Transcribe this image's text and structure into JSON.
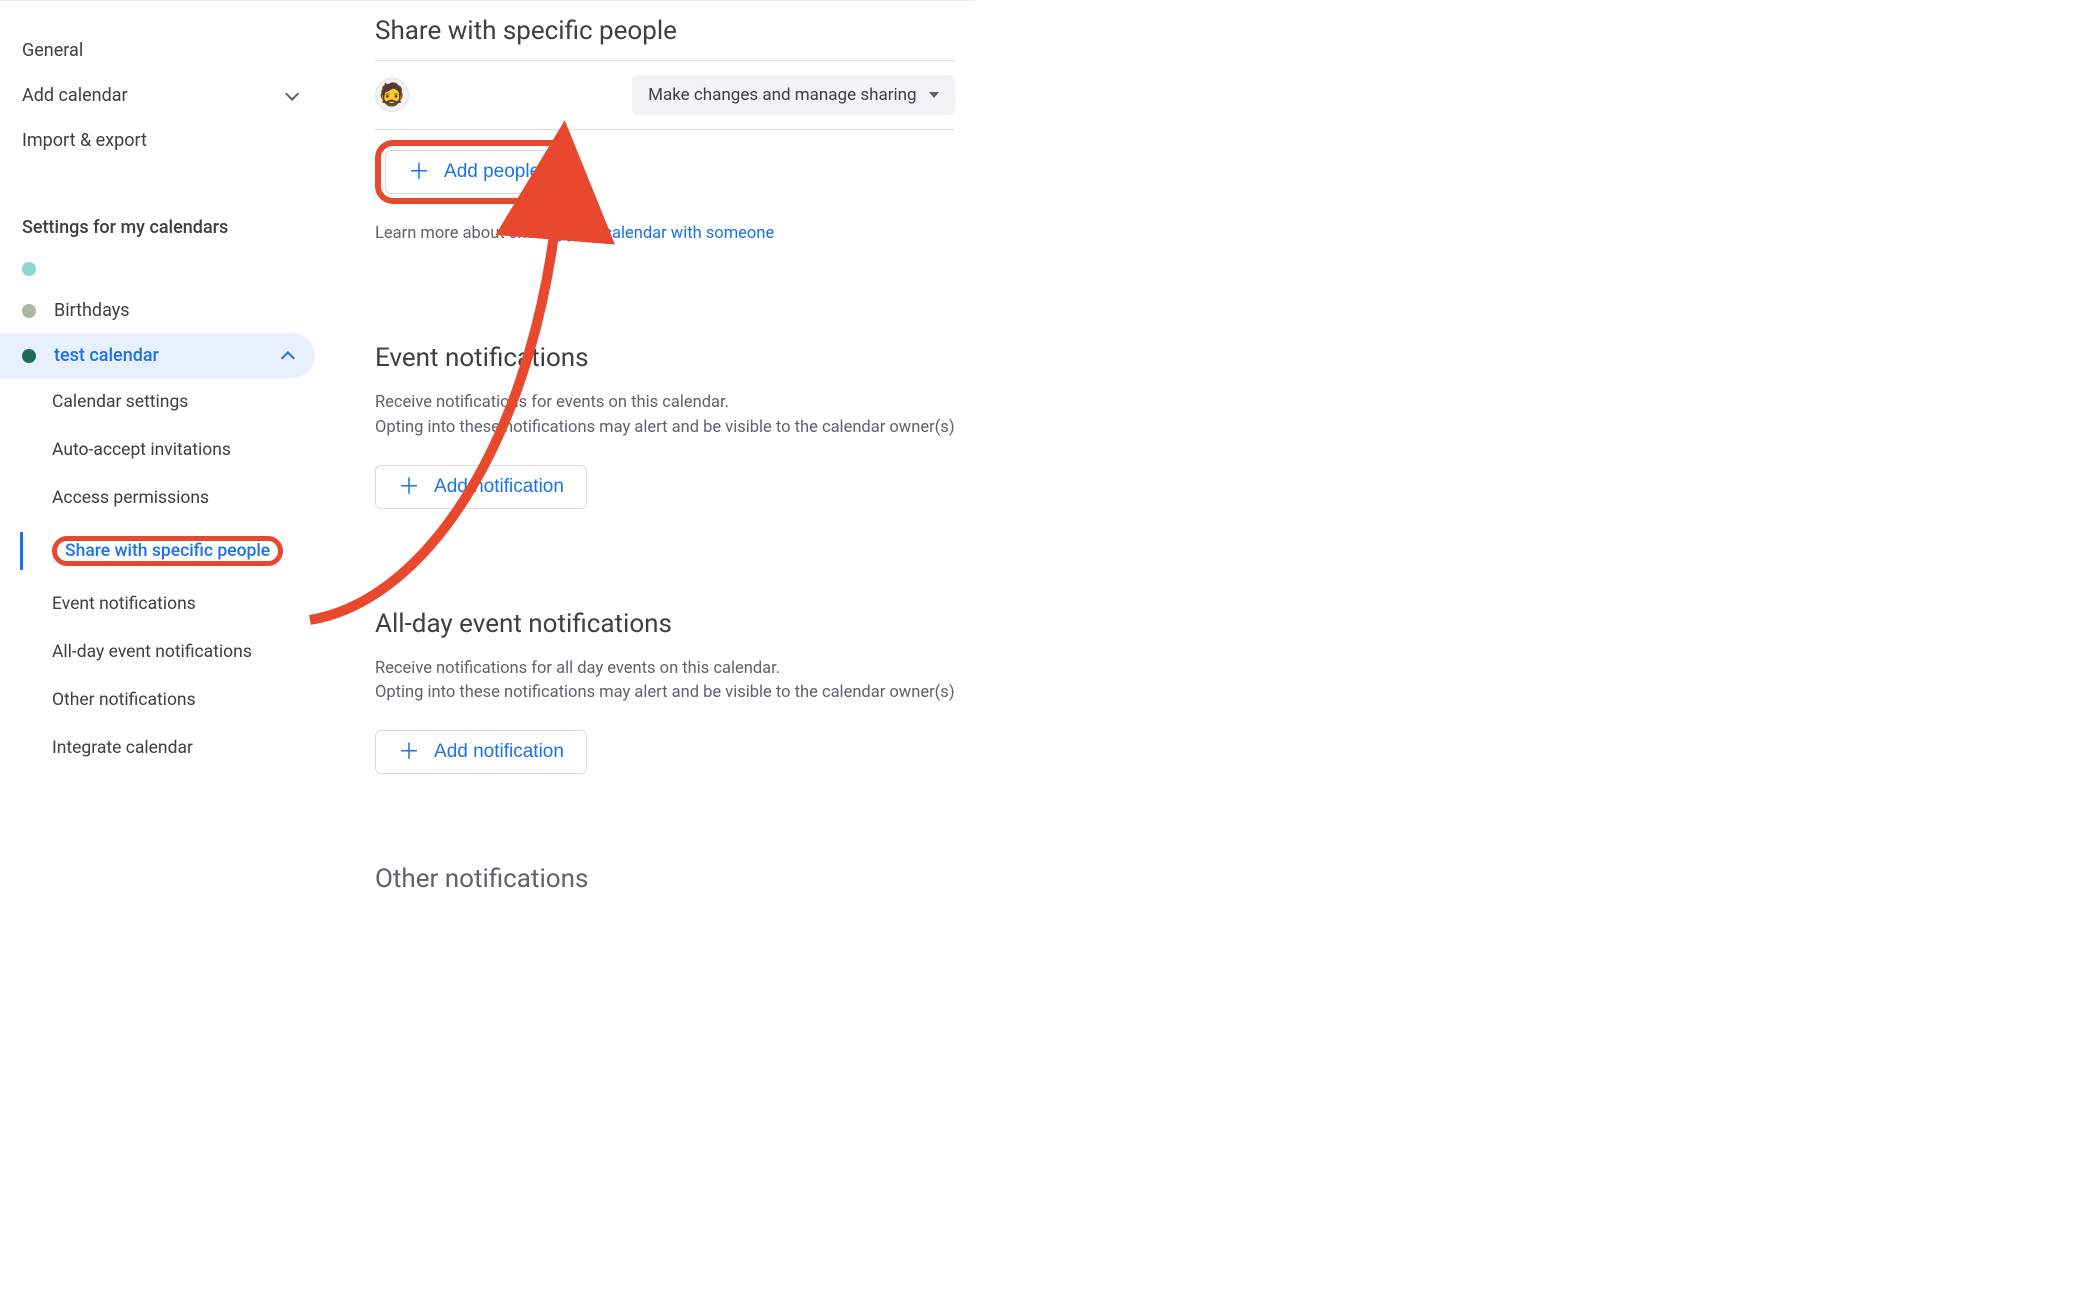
{
  "sidebar": {
    "general": "General",
    "add_calendar": "Add calendar",
    "import_export": "Import & export",
    "my_calendars_header": "Settings for my calendars",
    "calendars": [
      {
        "name": "",
        "color": "#8fd7cc"
      },
      {
        "name": "Birthdays",
        "color": "#a9b7a3"
      },
      {
        "name": "test calendar",
        "color": "#1b6b55",
        "selected": true
      }
    ],
    "subitems": [
      "Calendar settings",
      "Auto-accept invitations",
      "Access permissions",
      "Share with specific people",
      "Event notifications",
      "All-day event notifications",
      "Other notifications",
      "Integrate calendar"
    ],
    "active_subitem_index": 3
  },
  "share_section": {
    "title": "Share with specific people",
    "permission_label": "Make changes and manage sharing",
    "add_people_label": "Add people",
    "learn_prefix": "Learn more about ",
    "learn_link": "sharing your calendar with someone"
  },
  "event_notifications": {
    "title": "Event notifications",
    "line1": "Receive notifications for events on this calendar.",
    "line2": "Opting into these notifications may alert and be visible to the calendar owner(s)",
    "add_label": "Add notification"
  },
  "allday_notifications": {
    "title": "All-day event notifications",
    "line1": "Receive notifications for all day events on this calendar.",
    "line2": "Opting into these notifications may alert and be visible to the calendar owner(s)",
    "add_label": "Add notification"
  },
  "other_notifications": {
    "title": "Other notifications"
  },
  "annotation": {
    "highlight_color": "#e8492e"
  }
}
